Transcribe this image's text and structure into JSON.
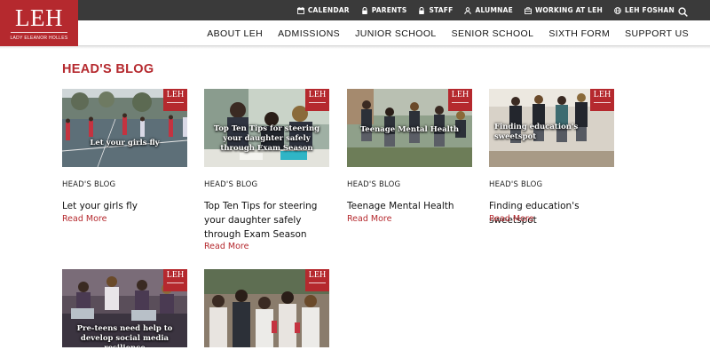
{
  "brand": {
    "logo_text": "LEH",
    "logo_subtitle": "LADY ELEANOR HOLLES",
    "badge_text": "LEH",
    "accent_color": "#b5292e",
    "topbar_color": "#3a3a3a"
  },
  "utility_nav": [
    {
      "label": "CALENDAR",
      "icon": "calendar-icon"
    },
    {
      "label": "PARENTS",
      "icon": "lock-icon"
    },
    {
      "label": "STAFF",
      "icon": "lock-icon"
    },
    {
      "label": "ALUMNAE",
      "icon": "person-icon"
    },
    {
      "label": "WORKING AT LEH",
      "icon": "briefcase-icon"
    },
    {
      "label": "LEH FOSHAN",
      "icon": "globe-icon"
    }
  ],
  "search": {
    "icon": "search-icon"
  },
  "main_nav": [
    {
      "label": "ABOUT LEH"
    },
    {
      "label": "ADMISSIONS"
    },
    {
      "label": "JUNIOR SCHOOL"
    },
    {
      "label": "SENIOR SCHOOL"
    },
    {
      "label": "SIXTH FORM"
    },
    {
      "label": "SUPPORT US"
    }
  ],
  "section": {
    "title": "HEAD'S BLOG"
  },
  "posts": [
    {
      "category": "HEAD'S BLOG",
      "image_caption": "Let your girls fly",
      "title": "Let your girls fly",
      "read_more": "Read More"
    },
    {
      "category": "HEAD'S BLOG",
      "image_caption": "Top Ten Tips for steering your daughter safely through Exam Season",
      "title": "Top Ten Tips for steering your daughter safely through Exam Season",
      "read_more": "Read More"
    },
    {
      "category": "HEAD'S BLOG",
      "image_caption": "Teenage Mental Health",
      "title": "Teenage Mental Health",
      "read_more": "Read More"
    },
    {
      "category": "HEAD'S BLOG",
      "image_caption": "Finding education's sweetspot",
      "title": "Finding education's sweetspot",
      "read_more": "Read More"
    },
    {
      "image_caption": "Pre-teens need help to develop social media resilience"
    },
    {
      "image_caption": ""
    }
  ]
}
